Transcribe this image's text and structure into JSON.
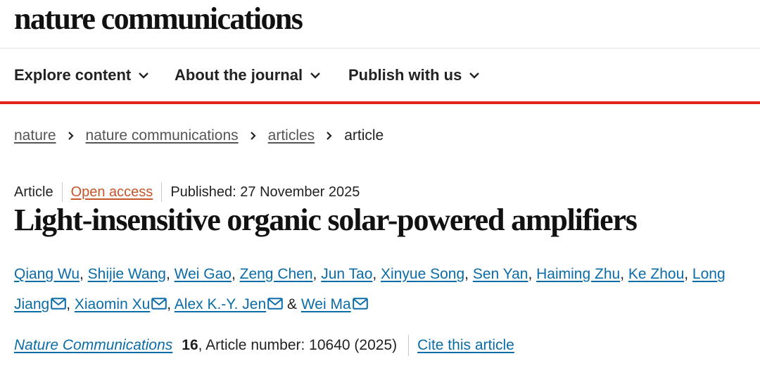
{
  "site": {
    "logo": "nature communications"
  },
  "nav": {
    "items": [
      {
        "label": "Explore content"
      },
      {
        "label": "About the journal"
      },
      {
        "label": "Publish with us"
      }
    ]
  },
  "colors": {
    "accent": "#e3231a",
    "link": "#0b6ca8",
    "open_access": "#c4562a"
  },
  "breadcrumb": {
    "items": [
      {
        "label": "nature"
      },
      {
        "label": "nature communications"
      },
      {
        "label": "articles"
      },
      {
        "label": "article"
      }
    ]
  },
  "article": {
    "type": "Article",
    "access": "Open access",
    "published": "Published: 27 November 2025",
    "title": "Light-insensitive organic solar-powered amplifiers",
    "authors": [
      {
        "name": "Qiang Wu",
        "sep": ", "
      },
      {
        "name": "Shijie Wang",
        "sep": ", "
      },
      {
        "name": "Wei Gao",
        "sep": ", "
      },
      {
        "name": "Zeng Chen",
        "sep": ", "
      },
      {
        "name": "Jun Tao",
        "sep": ", "
      },
      {
        "name": "Xinyue Song",
        "sep": ", "
      },
      {
        "name": "Sen Yan",
        "sep": ", "
      },
      {
        "name": "Haiming Zhu",
        "sep": ", "
      },
      {
        "name": "Ke Zhou",
        "sep": ", "
      },
      {
        "name": "Long Jiang",
        "sep": ", ",
        "icon": "mail-icon"
      },
      {
        "name": "Xiaomin Xu",
        "sep": ", ",
        "icon": "mail-icon"
      },
      {
        "name": "Alex K.-Y. Jen",
        "sep": " & ",
        "icon": "mail-icon"
      },
      {
        "name": "Wei Ma",
        "sep": "",
        "icon": "mail-icon"
      }
    ]
  },
  "citation": {
    "journal": "Nature Communications",
    "volume": "16",
    "article_number": ", Article number: 10640 (2025)",
    "cite_label": "Cite this article"
  }
}
